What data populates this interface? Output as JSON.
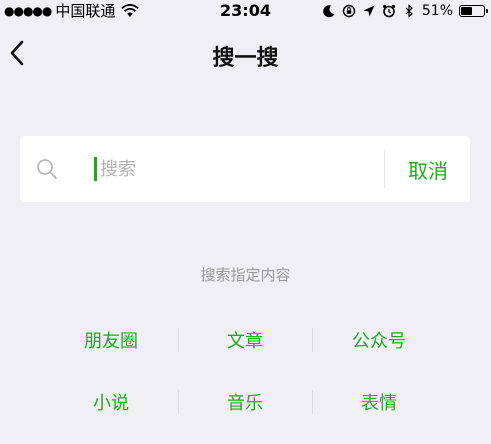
{
  "status_bar": {
    "signal_dots": "●●●●●",
    "carrier": "中国联通",
    "time": "23:04",
    "battery_percent": "51%",
    "battery_level": 0.51,
    "icons": [
      "wifi-icon",
      "moon-icon",
      "orientation-lock-icon",
      "location-icon",
      "alarm-icon",
      "bluetooth-icon",
      "battery-icon"
    ]
  },
  "nav": {
    "title": "搜一搜",
    "back_icon": "chevron-left-icon"
  },
  "search": {
    "placeholder": "搜索",
    "value": "",
    "cancel_label": "取消",
    "icon": "search-icon"
  },
  "hint": "搜索指定内容",
  "categories": [
    [
      "朋友圈",
      "文章",
      "公众号"
    ],
    [
      "小说",
      "音乐",
      "表情"
    ]
  ],
  "colors": {
    "accent": "#1aad19",
    "background": "#efeff4",
    "hint_text": "#9b9b9b"
  }
}
